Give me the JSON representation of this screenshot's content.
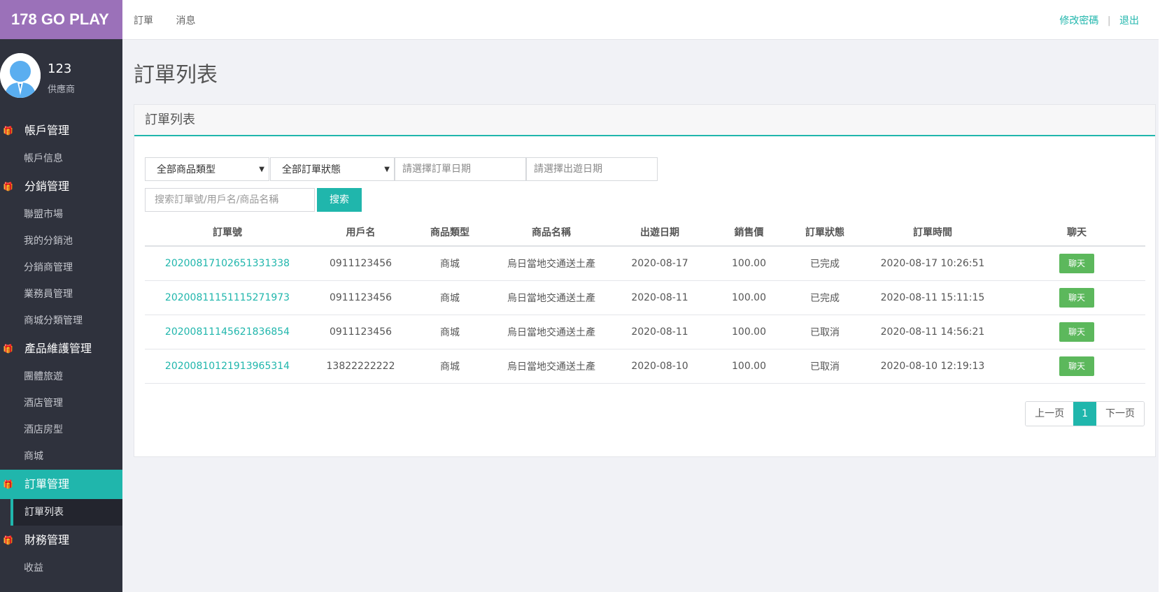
{
  "brand": "178 GO PLAY",
  "user": {
    "name": "123",
    "role": "供應商"
  },
  "sidebar": {
    "groups": [
      {
        "label": "帳戶管理",
        "items": [
          "帳戶信息"
        ]
      },
      {
        "label": "分銷管理",
        "items": [
          "聯盟市場",
          "我的分銷池",
          "分銷商管理",
          "業務員管理",
          "商城分類管理"
        ]
      },
      {
        "label": "產品維護管理",
        "items": [
          "團體旅遊",
          "酒店管理",
          "酒店房型",
          "商城"
        ]
      },
      {
        "label": "訂單管理",
        "items": [
          "訂單列表"
        ]
      },
      {
        "label": "財務管理",
        "items": [
          "收益"
        ]
      }
    ]
  },
  "topnav": {
    "orders": "訂單",
    "messages": "消息",
    "change_password": "修改密碼",
    "divider": "|",
    "logout": "退出"
  },
  "page": {
    "title": "訂單列表",
    "panel_title": "訂單列表"
  },
  "filters": {
    "product_type": "全部商品類型",
    "order_status": "全部訂單狀態",
    "order_date_placeholder": "請選擇訂單日期",
    "travel_date_placeholder": "請選擇出遊日期",
    "search_placeholder": "搜索訂單號/用戶名/商品名稱",
    "search_button": "搜索"
  },
  "table": {
    "headers": [
      "訂單號",
      "用戶名",
      "商品類型",
      "商品名稱",
      "出遊日期",
      "銷售價",
      "訂單狀態",
      "訂單時間",
      "聊天"
    ],
    "rows": [
      [
        "20200817102651331338",
        "0911123456",
        "商城",
        "烏日當地交通送土產",
        "2020-08-17",
        "100.00",
        "已完成",
        "2020-08-17 10:26:51",
        "聊天"
      ],
      [
        "20200811151115271973",
        "0911123456",
        "商城",
        "烏日當地交通送土產",
        "2020-08-11",
        "100.00",
        "已完成",
        "2020-08-11 15:11:15",
        "聊天"
      ],
      [
        "20200811145621836854",
        "0911123456",
        "商城",
        "烏日當地交通送土產",
        "2020-08-11",
        "100.00",
        "已取消",
        "2020-08-11 14:56:21",
        "聊天"
      ],
      [
        "20200810121913965314",
        "13822222222",
        "商城",
        "烏日當地交通送土產",
        "2020-08-10",
        "100.00",
        "已取消",
        "2020-08-10 12:19:13",
        "聊天"
      ]
    ]
  },
  "pager": {
    "prev": "上一页",
    "current": "1",
    "next": "下一页"
  },
  "colors": {
    "accent": "#20b6ac",
    "brand": "#9b71b9",
    "sidebar": "#2f323d",
    "chat_button": "#5cb85c"
  },
  "icons": {
    "group_icon": "gift-icon"
  }
}
